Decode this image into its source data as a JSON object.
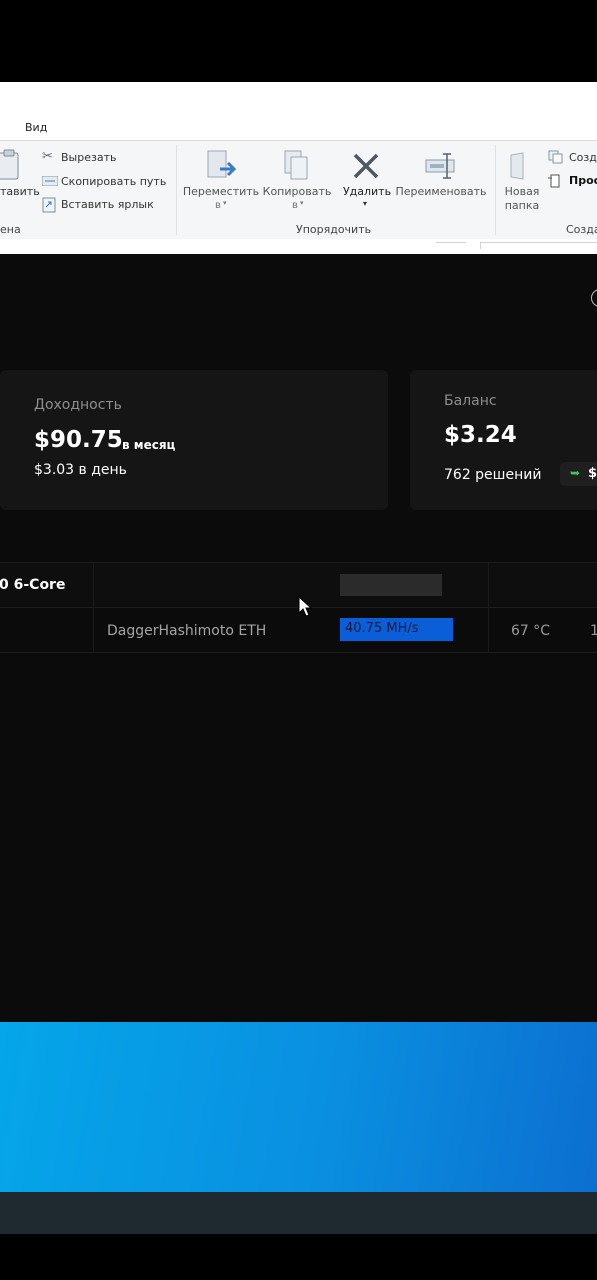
{
  "explorer": {
    "tab_view": "Вид",
    "clipboard": {
      "paste_partial": "тавить",
      "cut": "Вырезать",
      "copy_path": "Скопировать путь",
      "paste_shortcut": "Вставить ярлык",
      "group_partial": "ена"
    },
    "organize": {
      "move_to": "Переместить",
      "copy_to": "Копировать",
      "arrow_v": "в",
      "delete": "Удалить",
      "rename": "Переименовать",
      "group_label": "Упорядочить"
    },
    "create": {
      "new_folder_line1": "Новая",
      "new_folder_line2": "папка",
      "new_item_partial": "Созда",
      "easy_access_partial": "Прос",
      "group_partial": "Созда"
    }
  },
  "mining_app": {
    "profitability": {
      "label": "Доходность",
      "amount": "$90.75",
      "period": "в месяц",
      "daily": "$3.03 в день"
    },
    "balance": {
      "label": "Баланс",
      "amount": "$3.24",
      "solutions": "762 решений",
      "payout_partial": "$"
    },
    "device": {
      "name_partial": "0 6-Core",
      "algorithm": "DaggerHashimoto ETH",
      "hashrate": "40.75 MH/s",
      "temperature": "67 °C",
      "extra_partial": "1"
    }
  },
  "colors": {
    "app_bg": "#0b0b0b",
    "card_bg": "#151515",
    "hashrate_highlight": "#0a5fd8",
    "payout_chip_green": "#3cc65a",
    "desktop_blue": "#05a6ea"
  }
}
